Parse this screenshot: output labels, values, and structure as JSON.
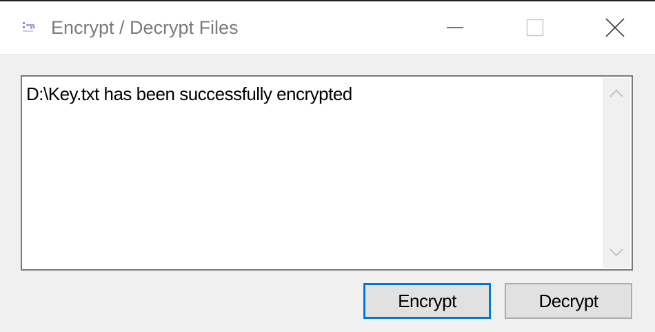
{
  "window": {
    "title": "Encrypt / Decrypt Files",
    "icon": "app-key-icon",
    "controls": {
      "minimize": "minimize-icon",
      "maximize": "maximize-icon",
      "close": "close-icon"
    }
  },
  "output": {
    "text": "D:\\Key.txt has been successfully encrypted"
  },
  "buttons": {
    "encrypt_label": "Encrypt",
    "decrypt_label": "Decrypt"
  },
  "colors": {
    "focus_accent": "#0078d7",
    "title_text": "#7a7a7a",
    "button_face": "#e1e1e1"
  }
}
